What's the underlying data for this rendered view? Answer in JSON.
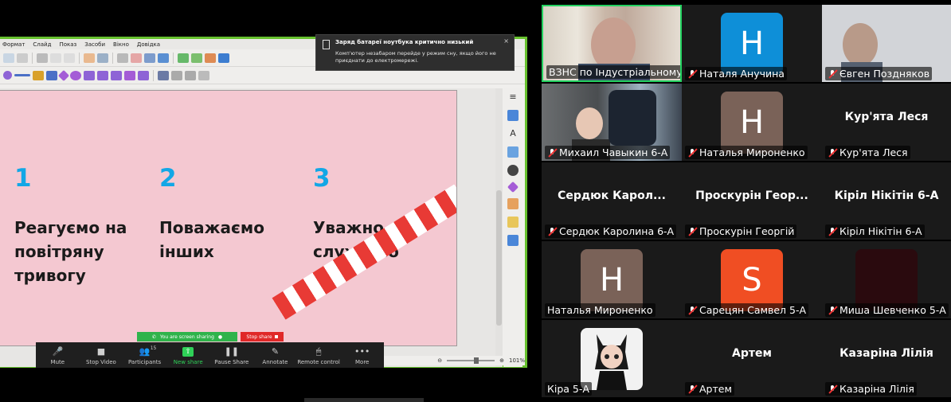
{
  "app_menu": [
    "Формат",
    "Слайд",
    "Показ",
    "Засоби",
    "Вікно",
    "Довідка"
  ],
  "notification": {
    "title": "Заряд батареї ноутбука критично низький",
    "body": "Комп'ютер незабаром перейде у режим сну, якщо його не приєднати до електромережі.",
    "close": "×"
  },
  "slide": {
    "items": [
      {
        "num": "1",
        "text": "Реагуємо на повітряну тривогу"
      },
      {
        "num": "2",
        "text": "Поважаємо інших"
      },
      {
        "num": "3",
        "text": "Уважно слухаємо"
      }
    ]
  },
  "statusbar": {
    "braces": "{}",
    "minus": "⊖",
    "plus": "⊕",
    "zoom": "101%"
  },
  "share_bar": {
    "sharing": "You are screen sharing",
    "stop": "Stop share"
  },
  "controls": [
    {
      "icon": "microphone-icon",
      "glyph": "🎤",
      "label": "Mute",
      "accent": ""
    },
    {
      "icon": "video-camera-icon",
      "glyph": "■",
      "label": "Stop Video",
      "accent": ""
    },
    {
      "icon": "participants-icon",
      "glyph": "👥",
      "label": "Participants",
      "count": "15",
      "accent": ""
    },
    {
      "icon": "new-share-icon",
      "glyph": "⇧",
      "label": "New share",
      "accent": "#2fd158"
    },
    {
      "icon": "pause-icon",
      "glyph": "❚❚",
      "label": "Pause Share",
      "accent": ""
    },
    {
      "icon": "annotate-icon",
      "glyph": "✎",
      "label": "Annotate",
      "accent": ""
    },
    {
      "icon": "remote-control-icon",
      "glyph": "🖱",
      "label": "Remote control",
      "accent": ""
    },
    {
      "icon": "more-icon",
      "glyph": "•••",
      "label": "More",
      "accent": ""
    }
  ],
  "participants": [
    {
      "name": "ВЗНС по Індустріальному ...",
      "type": "video",
      "active": true,
      "muted": false
    },
    {
      "name": "Наталя Анучина",
      "type": "avatar",
      "letter": "H",
      "color": "#0e8fd8",
      "muted": true
    },
    {
      "name": "Євген Поздняков",
      "type": "video",
      "muted": true
    },
    {
      "name": "Михаил Чавыкин 6-А",
      "type": "video",
      "muted": true
    },
    {
      "name": "Наталья Мироненко",
      "type": "avatar",
      "letter": "H",
      "color": "#7a6258",
      "muted": true
    },
    {
      "name": "Кур'ята Леся",
      "type": "name",
      "big": "Кур'ята Леся",
      "muted": true
    },
    {
      "name": "Сердюк Каролина 6-А",
      "type": "name",
      "big": "Сердюк  Карол...",
      "muted": true
    },
    {
      "name": "Проскурін Георгій",
      "type": "name",
      "big": "Проскурін  Геор...",
      "muted": true
    },
    {
      "name": "Кіріл Нікітін 6-А",
      "type": "name",
      "big": "Кіріл Нікітін 6-А",
      "muted": true
    },
    {
      "name": "Наталья Мироненко",
      "type": "avatar",
      "letter": "H",
      "color": "#7a6258",
      "muted": false
    },
    {
      "name": "Сарецян Самвел 5-А",
      "type": "avatar",
      "letter": "S",
      "color": "#f04e23",
      "muted": true
    },
    {
      "name": "Миша Шевченко 5-А",
      "type": "dark",
      "muted": true
    },
    {
      "name": "Кіра 5-А",
      "type": "cartoon",
      "muted": false
    },
    {
      "name": "Артем",
      "type": "name",
      "big": "Артем",
      "muted": true
    },
    {
      "name": "Казаріна Лілія",
      "type": "name",
      "big": "Казаріна Лілія",
      "muted": true
    }
  ]
}
